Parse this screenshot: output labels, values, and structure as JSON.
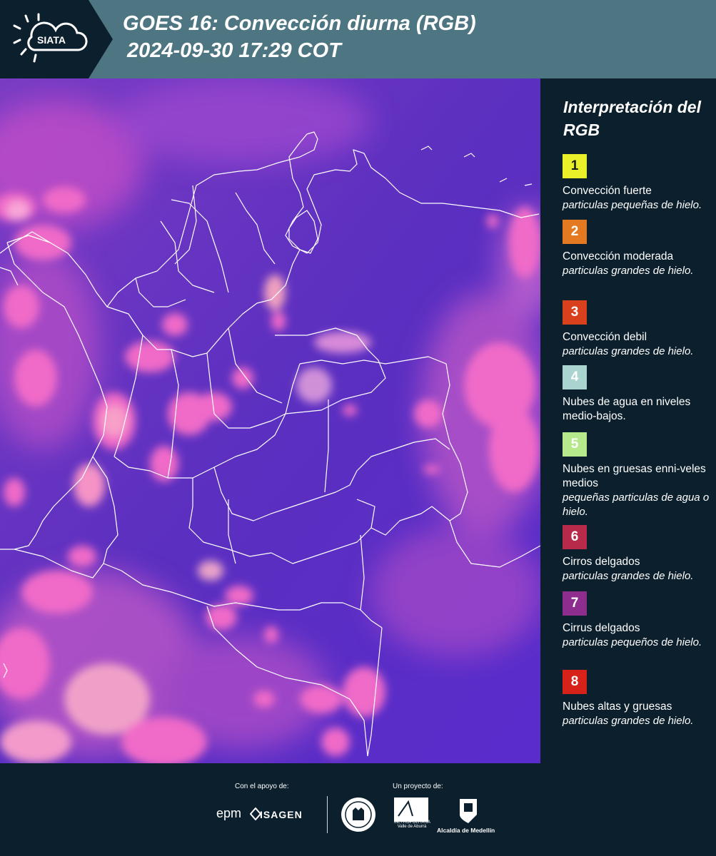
{
  "header": {
    "logo_text": "SIATA",
    "title_line1": "GOES 16: Convección diurna (RGB)",
    "title_line2": "2024-09-30 17:29 COT"
  },
  "colors": {
    "header_bg": "#4e7682",
    "panel_bg": "#0c1f2c",
    "map_bg": "#5a2fbf",
    "cloud_pink": "#f06bc8",
    "border_lines": "#ffffff"
  },
  "legend": {
    "title": "Interpretación del RGB",
    "items": [
      {
        "num": "1",
        "color": "#e8f02a",
        "name": "Convección fuerte",
        "desc": "particulas pequeñas de hielo."
      },
      {
        "num": "2",
        "color": "#e37a22",
        "name": "Convección moderada",
        "desc": "particulas grandes de hielo."
      },
      {
        "num": "3",
        "color": "#d8411c",
        "name": "Convección debil",
        "desc": "particulas grandes de hielo."
      },
      {
        "num": "4",
        "color": "#a9d4cf",
        "name": "Nubes de agua en niveles medio-bajos.",
        "desc": ""
      },
      {
        "num": "5",
        "color": "#b6e88c",
        "name": "Nubes en gruesas enni-veles medios",
        "desc": "pequeñas particulas de agua o hielo."
      },
      {
        "num": "6",
        "color": "#b72a4a",
        "name": "Cirros delgados",
        "desc": "particulas grandes de hielo."
      },
      {
        "num": "7",
        "color": "#8d2d8e",
        "name": "Cirrus delgados",
        "desc": "particulas pequeños de hielo."
      },
      {
        "num": "8",
        "color": "#d62219",
        "name": "Nubes altas y gruesas",
        "desc": "particulas grandes de hielo."
      }
    ]
  },
  "footer": {
    "support_label": "Con el apoyo de:",
    "project_label": "Un proyecto de:",
    "sponsor1": "epm",
    "sponsor2": "ISAGEN",
    "partner_metro": "METROPOLITANA Valle de Aburrá",
    "partner_metro_script": "Área",
    "partner_medellin": "Alcaldía de Medellín"
  }
}
